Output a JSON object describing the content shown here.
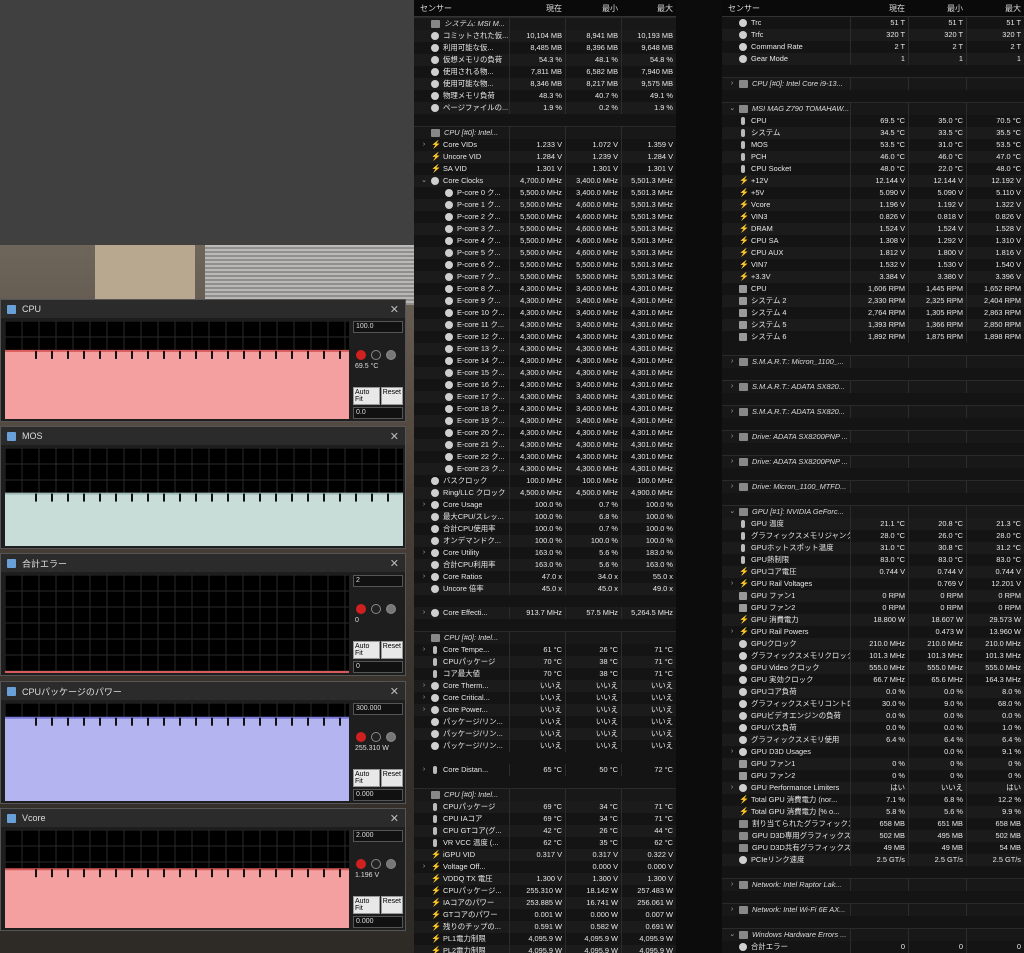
{
  "graphs": [
    {
      "title": "CPU",
      "max": "100.0",
      "current": "69.5 °C",
      "min": "0.0",
      "fill": "#f4a0a0",
      "line": "#d85a5a",
      "level": 0.695,
      "autofit": "Auto Fit",
      "reset": "Reset"
    },
    {
      "title": "MOS",
      "max": "",
      "current": "",
      "min": "",
      "fill": "#c8dcd8",
      "line": "#9fb8b4",
      "level": 0.535,
      "autofit": "",
      "reset": ""
    },
    {
      "title": "合計エラー",
      "max": "2",
      "current": "0",
      "min": "0",
      "fill": "#f4a0a0",
      "line": "#d85a5a",
      "level": 0.0,
      "autofit": "Auto Fit",
      "reset": "Reset"
    },
    {
      "title": "CPUパッケージのパワー",
      "max": "300.000",
      "current": "255.310 W",
      "min": "0.000",
      "fill": "#b4b4f0",
      "line": "#7a7ad8",
      "level": 0.85,
      "autofit": "Auto Fit",
      "reset": "Reset"
    },
    {
      "title": "Vcore",
      "max": "2.000",
      "current": "1.196 V",
      "min": "0.000",
      "fill": "#f4a0a0",
      "line": "#d85a5a",
      "level": 0.6,
      "autofit": "Auto Fit",
      "reset": "Reset"
    }
  ],
  "columns": {
    "sensor": "センサー",
    "current": "現在",
    "min": "最小",
    "max": "最大"
  },
  "left_rows": [
    {
      "t": "g",
      "n": "システム: MSI M..."
    },
    {
      "i": "dot",
      "n": "コミットされた仮...",
      "c": "10,104 MB",
      "mi": "8,941 MB",
      "ma": "10,193 MB"
    },
    {
      "i": "dot",
      "n": "利用可能な仮...",
      "c": "8,485 MB",
      "mi": "8,396 MB",
      "ma": "9,648 MB"
    },
    {
      "i": "dot",
      "n": "仮想メモリの負荷",
      "c": "54.3 %",
      "mi": "48.1 %",
      "ma": "54.8 %"
    },
    {
      "i": "dot",
      "n": "使用される物...",
      "c": "7,811 MB",
      "mi": "6,582 MB",
      "ma": "7,940 MB"
    },
    {
      "i": "dot",
      "n": "使用可能な物...",
      "c": "8,346 MB",
      "mi": "8,217 MB",
      "ma": "9,575 MB"
    },
    {
      "i": "dot",
      "n": "物理メモリ負荷",
      "c": "48.3 %",
      "mi": "40.7 %",
      "ma": "49.1 %"
    },
    {
      "i": "dot",
      "n": "ページファイルの...",
      "c": "1.9 %",
      "mi": "0.2 %",
      "ma": "1.9 %"
    },
    {
      "t": "b"
    },
    {
      "t": "g",
      "n": "CPU [#0]: Intel..."
    },
    {
      "a": ">",
      "i": "bolt",
      "n": "Core VIDs",
      "c": "1.233 V",
      "mi": "1.072 V",
      "ma": "1.359 V"
    },
    {
      "i": "bolt",
      "n": "Uncore VID",
      "c": "1.284 V",
      "mi": "1.239 V",
      "ma": "1.284 V"
    },
    {
      "i": "bolt",
      "n": "SA VID",
      "c": "1.301 V",
      "mi": "1.301 V",
      "ma": "1.301 V"
    },
    {
      "a": "v",
      "i": "dot",
      "n": "Core Clocks",
      "c": "4,700.0 MHz",
      "mi": "3,400.0 MHz",
      "ma": "5,501.3 MHz"
    },
    {
      "s": 1,
      "i": "dot",
      "n": "P-core 0 ク...",
      "c": "5,500.0 MHz",
      "mi": "3,400.0 MHz",
      "ma": "5,501.3 MHz"
    },
    {
      "s": 1,
      "i": "dot",
      "n": "P-core 1 ク...",
      "c": "5,500.0 MHz",
      "mi": "4,600.0 MHz",
      "ma": "5,501.3 MHz"
    },
    {
      "s": 1,
      "i": "dot",
      "n": "P-core 2 ク...",
      "c": "5,500.0 MHz",
      "mi": "4,600.0 MHz",
      "ma": "5,501.3 MHz"
    },
    {
      "s": 1,
      "i": "dot",
      "n": "P-core 3 ク...",
      "c": "5,500.0 MHz",
      "mi": "4,600.0 MHz",
      "ma": "5,501.3 MHz"
    },
    {
      "s": 1,
      "i": "dot",
      "n": "P-core 4 ク...",
      "c": "5,500.0 MHz",
      "mi": "4,600.0 MHz",
      "ma": "5,501.3 MHz"
    },
    {
      "s": 1,
      "i": "dot",
      "n": "P-core 5 ク...",
      "c": "5,500.0 MHz",
      "mi": "4,600.0 MHz",
      "ma": "5,501.3 MHz"
    },
    {
      "s": 1,
      "i": "dot",
      "n": "P-core 6 ク...",
      "c": "5,500.0 MHz",
      "mi": "5,500.0 MHz",
      "ma": "5,501.3 MHz"
    },
    {
      "s": 1,
      "i": "dot",
      "n": "P-core 7 ク...",
      "c": "5,500.0 MHz",
      "mi": "5,500.0 MHz",
      "ma": "5,501.3 MHz"
    },
    {
      "s": 1,
      "i": "dot",
      "n": "E-core 8 ク...",
      "c": "4,300.0 MHz",
      "mi": "3,400.0 MHz",
      "ma": "4,301.0 MHz"
    },
    {
      "s": 1,
      "i": "dot",
      "n": "E-core 9 ク...",
      "c": "4,300.0 MHz",
      "mi": "3,400.0 MHz",
      "ma": "4,301.0 MHz"
    },
    {
      "s": 1,
      "i": "dot",
      "n": "E-core 10 ク...",
      "c": "4,300.0 MHz",
      "mi": "3,400.0 MHz",
      "ma": "4,301.0 MHz"
    },
    {
      "s": 1,
      "i": "dot",
      "n": "E-core 11 ク...",
      "c": "4,300.0 MHz",
      "mi": "3,400.0 MHz",
      "ma": "4,301.0 MHz"
    },
    {
      "s": 1,
      "i": "dot",
      "n": "E-core 12 ク...",
      "c": "4,300.0 MHz",
      "mi": "4,300.0 MHz",
      "ma": "4,301.0 MHz"
    },
    {
      "s": 1,
      "i": "dot",
      "n": "E-core 13 ク...",
      "c": "4,300.0 MHz",
      "mi": "4,300.0 MHz",
      "ma": "4,301.0 MHz"
    },
    {
      "s": 1,
      "i": "dot",
      "n": "E-core 14 ク...",
      "c": "4,300.0 MHz",
      "mi": "4,300.0 MHz",
      "ma": "4,301.0 MHz"
    },
    {
      "s": 1,
      "i": "dot",
      "n": "E-core 15 ク...",
      "c": "4,300.0 MHz",
      "mi": "4,300.0 MHz",
      "ma": "4,301.0 MHz"
    },
    {
      "s": 1,
      "i": "dot",
      "n": "E-core 16 ク...",
      "c": "4,300.0 MHz",
      "mi": "3,400.0 MHz",
      "ma": "4,301.0 MHz"
    },
    {
      "s": 1,
      "i": "dot",
      "n": "E-core 17 ク...",
      "c": "4,300.0 MHz",
      "mi": "3,400.0 MHz",
      "ma": "4,301.0 MHz"
    },
    {
      "s": 1,
      "i": "dot",
      "n": "E-core 18 ク...",
      "c": "4,300.0 MHz",
      "mi": "3,400.0 MHz",
      "ma": "4,301.0 MHz"
    },
    {
      "s": 1,
      "i": "dot",
      "n": "E-core 19 ク...",
      "c": "4,300.0 MHz",
      "mi": "3,400.0 MHz",
      "ma": "4,301.0 MHz"
    },
    {
      "s": 1,
      "i": "dot",
      "n": "E-core 20 ク...",
      "c": "4,300.0 MHz",
      "mi": "4,300.0 MHz",
      "ma": "4,301.0 MHz"
    },
    {
      "s": 1,
      "i": "dot",
      "n": "E-core 21 ク...",
      "c": "4,300.0 MHz",
      "mi": "4,300.0 MHz",
      "ma": "4,301.0 MHz"
    },
    {
      "s": 1,
      "i": "dot",
      "n": "E-core 22 ク...",
      "c": "4,300.0 MHz",
      "mi": "4,300.0 MHz",
      "ma": "4,301.0 MHz"
    },
    {
      "s": 1,
      "i": "dot",
      "n": "E-core 23 ク...",
      "c": "4,300.0 MHz",
      "mi": "4,300.0 MHz",
      "ma": "4,301.0 MHz"
    },
    {
      "i": "dot",
      "n": "バスクロック",
      "c": "100.0 MHz",
      "mi": "100.0 MHz",
      "ma": "100.0 MHz"
    },
    {
      "i": "dot",
      "n": "Ring/LLC クロック",
      "c": "4,500.0 MHz",
      "mi": "4,500.0 MHz",
      "ma": "4,900.0 MHz"
    },
    {
      "a": ">",
      "i": "dot",
      "n": "Core Usage",
      "c": "100.0 %",
      "mi": "0.7 %",
      "ma": "100.0 %"
    },
    {
      "i": "dot",
      "n": "最大CPU/スレッ...",
      "c": "100.0 %",
      "mi": "6.8 %",
      "ma": "100.0 %"
    },
    {
      "i": "dot",
      "n": "合計CPU使用率",
      "c": "100.0 %",
      "mi": "0.7 %",
      "ma": "100.0 %"
    },
    {
      "i": "dot",
      "n": "オンデマンドク...",
      "c": "100.0 %",
      "mi": "100.0 %",
      "ma": "100.0 %"
    },
    {
      "a": ">",
      "i": "dot",
      "n": "Core Utility",
      "c": "163.0 %",
      "mi": "5.6 %",
      "ma": "183.0 %"
    },
    {
      "i": "dot",
      "n": "合計CPU利用率",
      "c": "163.0 %",
      "mi": "5.6 %",
      "ma": "163.0 %"
    },
    {
      "a": ">",
      "i": "dot",
      "n": "Core Ratios",
      "c": "47.0 x",
      "mi": "34.0 x",
      "ma": "55.0 x"
    },
    {
      "i": "dot",
      "n": "Uncore 倍率",
      "c": "45.0 x",
      "mi": "45.0 x",
      "ma": "49.0 x"
    },
    {
      "t": "b"
    },
    {
      "a": ">",
      "i": "dot",
      "n": "Core Effecti...",
      "c": "913.7 MHz",
      "mi": "57.5 MHz",
      "ma": "5,264.5 MHz"
    },
    {
      "t": "b"
    },
    {
      "t": "g",
      "n": "CPU [#0]: Intel..."
    },
    {
      "a": ">",
      "i": "therm",
      "n": "Core Tempe...",
      "c": "61 °C",
      "mi": "26 °C",
      "ma": "71 °C"
    },
    {
      "i": "therm",
      "n": "CPUパッケージ",
      "c": "70 °C",
      "mi": "38 °C",
      "ma": "71 °C"
    },
    {
      "i": "therm",
      "n": "コア最大値",
      "c": "70 °C",
      "mi": "38 °C",
      "ma": "71 °C"
    },
    {
      "a": ">",
      "i": "dot",
      "n": "Core Therm...",
      "c": "いいえ",
      "mi": "いいえ",
      "ma": "いいえ"
    },
    {
      "a": ">",
      "i": "dot",
      "n": "Core Critical...",
      "c": "いいえ",
      "mi": "いいえ",
      "ma": "いいえ"
    },
    {
      "a": ">",
      "i": "dot",
      "n": "Core Power...",
      "c": "いいえ",
      "mi": "いいえ",
      "ma": "いいえ"
    },
    {
      "i": "dot",
      "n": "パッケージ/リン...",
      "c": "いいえ",
      "mi": "いいえ",
      "ma": "いいえ"
    },
    {
      "i": "dot",
      "n": "パッケージ/リン...",
      "c": "いいえ",
      "mi": "いいえ",
      "ma": "いいえ"
    },
    {
      "i": "dot",
      "n": "パッケージ/リン...",
      "c": "いいえ",
      "mi": "いいえ",
      "ma": "いいえ"
    },
    {
      "t": "b"
    },
    {
      "a": ">",
      "i": "therm",
      "n": "Core Distan...",
      "c": "65 °C",
      "mi": "50 °C",
      "ma": "72 °C"
    },
    {
      "t": "b"
    },
    {
      "t": "g",
      "n": "CPU [#0]: Intel..."
    },
    {
      "i": "therm",
      "n": "CPUパッケージ",
      "c": "69 °C",
      "mi": "34 °C",
      "ma": "71 °C"
    },
    {
      "i": "therm",
      "n": "CPU IAコア",
      "c": "69 °C",
      "mi": "34 °C",
      "ma": "71 °C"
    },
    {
      "i": "therm",
      "n": "CPU GTコア(グ...",
      "c": "42 °C",
      "mi": "26 °C",
      "ma": "44 °C"
    },
    {
      "i": "therm",
      "n": "VR VCC 温度 (...",
      "c": "62 °C",
      "mi": "35 °C",
      "ma": "62 °C"
    },
    {
      "i": "bolt",
      "n": "iGPU VID",
      "c": "0.317 V",
      "mi": "0.317 V",
      "ma": "0.322 V"
    },
    {
      "a": ">",
      "i": "bolt",
      "n": "Voltage Off...",
      "c": "",
      "mi": "0.000 V",
      "ma": "0.000 V"
    },
    {
      "i": "bolt",
      "n": "VDDQ TX 電圧",
      "c": "1.300 V",
      "mi": "1.300 V",
      "ma": "1.300 V"
    },
    {
      "i": "bolt",
      "n": "CPUパッケージ...",
      "c": "255.310 W",
      "mi": "18.142 W",
      "ma": "257.483 W"
    },
    {
      "i": "bolt",
      "n": "IAコアのパワー",
      "c": "253.885 W",
      "mi": "16.741 W",
      "ma": "256.061 W"
    },
    {
      "i": "bolt",
      "n": "GTコアのパワー",
      "c": "0.001 W",
      "mi": "0.000 W",
      "ma": "0.007 W"
    },
    {
      "i": "bolt",
      "n": "残りのチップの...",
      "c": "0.591 W",
      "mi": "0.582 W",
      "ma": "0.691 W"
    },
    {
      "i": "bolt",
      "n": "PL1電力制限",
      "c": "4,095.9 W",
      "mi": "4,095.9 W",
      "ma": "4,095.9 W"
    },
    {
      "i": "bolt",
      "n": "PL2電力制限",
      "c": "4,095.9 W",
      "mi": "4,095.9 W",
      "ma": "4,095.9 W"
    }
  ],
  "right_rows": [
    {
      "i": "dot",
      "n": "Trc",
      "c": "51 T",
      "mi": "51 T",
      "ma": "51 T"
    },
    {
      "i": "dot",
      "n": "Trfc",
      "c": "320 T",
      "mi": "320 T",
      "ma": "320 T"
    },
    {
      "i": "dot",
      "n": "Command Rate",
      "c": "2 T",
      "mi": "2 T",
      "ma": "2 T"
    },
    {
      "i": "dot",
      "n": "Gear Mode",
      "c": "1",
      "mi": "1",
      "ma": "1"
    },
    {
      "t": "b"
    },
    {
      "t": "g",
      "a": ">",
      "n": "CPU [#0]: Intel Core i9-13..."
    },
    {
      "t": "b"
    },
    {
      "t": "g",
      "a": "v",
      "n": "MSI MAG Z790 TOMAHAW..."
    },
    {
      "i": "therm",
      "n": "CPU",
      "c": "69.5 °C",
      "mi": "35.0 °C",
      "ma": "70.5 °C"
    },
    {
      "i": "therm",
      "n": "システム",
      "c": "34.5 °C",
      "mi": "33.5 °C",
      "ma": "35.5 °C"
    },
    {
      "i": "therm",
      "n": "MOS",
      "c": "53.5 °C",
      "mi": "31.0 °C",
      "ma": "53.5 °C"
    },
    {
      "i": "therm",
      "n": "PCH",
      "c": "46.0 °C",
      "mi": "46.0 °C",
      "ma": "47.0 °C"
    },
    {
      "i": "therm",
      "n": "CPU Socket",
      "c": "48.0 °C",
      "mi": "22.0 °C",
      "ma": "48.0 °C"
    },
    {
      "i": "bolt",
      "n": "+12V",
      "c": "12.144 V",
      "mi": "12.144 V",
      "ma": "12.192 V"
    },
    {
      "i": "bolt",
      "n": "+5V",
      "c": "5.090 V",
      "mi": "5.090 V",
      "ma": "5.110 V"
    },
    {
      "i": "bolt",
      "n": "Vcore",
      "c": "1.196 V",
      "mi": "1.192 V",
      "ma": "1.322 V"
    },
    {
      "i": "bolt",
      "n": "VIN3",
      "c": "0.826 V",
      "mi": "0.818 V",
      "ma": "0.826 V"
    },
    {
      "i": "bolt",
      "n": "DRAM",
      "c": "1.524 V",
      "mi": "1.524 V",
      "ma": "1.528 V"
    },
    {
      "i": "bolt",
      "n": "CPU SA",
      "c": "1.308 V",
      "mi": "1.292 V",
      "ma": "1.310 V"
    },
    {
      "i": "bolt",
      "n": "CPU AUX",
      "c": "1.812 V",
      "mi": "1.800 V",
      "ma": "1.816 V"
    },
    {
      "i": "bolt",
      "n": "VIN7",
      "c": "1.532 V",
      "mi": "1.530 V",
      "ma": "1.540 V"
    },
    {
      "i": "bolt",
      "n": "+3.3V",
      "c": "3.384 V",
      "mi": "3.380 V",
      "ma": "3.396 V"
    },
    {
      "i": "fan",
      "n": "CPU",
      "c": "1,606 RPM",
      "mi": "1,445 RPM",
      "ma": "1,652 RPM"
    },
    {
      "i": "fan",
      "n": "システム 2",
      "c": "2,330 RPM",
      "mi": "2,325 RPM",
      "ma": "2,404 RPM"
    },
    {
      "i": "fan",
      "n": "システム 4",
      "c": "2,764 RPM",
      "mi": "1,305 RPM",
      "ma": "2,863 RPM"
    },
    {
      "i": "fan",
      "n": "システム 5",
      "c": "1,393 RPM",
      "mi": "1,366 RPM",
      "ma": "2,850 RPM"
    },
    {
      "i": "fan",
      "n": "システム 6",
      "c": "1,892 RPM",
      "mi": "1,875 RPM",
      "ma": "1,898 RPM"
    },
    {
      "t": "b"
    },
    {
      "t": "g",
      "a": ">",
      "n": "S.M.A.R.T.: Micron_1100_..."
    },
    {
      "t": "b"
    },
    {
      "t": "g",
      "a": ">",
      "n": "S.M.A.R.T.: ADATA SX820..."
    },
    {
      "t": "b"
    },
    {
      "t": "g",
      "a": ">",
      "n": "S.M.A.R.T.: ADATA SX820..."
    },
    {
      "t": "b"
    },
    {
      "t": "g",
      "a": ">",
      "n": "Drive: ADATA SX8200PNP ..."
    },
    {
      "t": "b"
    },
    {
      "t": "g",
      "a": ">",
      "n": "Drive: ADATA SX8200PNP ..."
    },
    {
      "t": "b"
    },
    {
      "t": "g",
      "a": ">",
      "n": "Drive: Micron_1100_MTFD..."
    },
    {
      "t": "b"
    },
    {
      "t": "g",
      "a": "v",
      "n": "GPU [#1]: NVIDIA GeForc..."
    },
    {
      "i": "therm",
      "n": "GPU 温度",
      "c": "21.1 °C",
      "mi": "20.8 °C",
      "ma": "21.3 °C"
    },
    {
      "i": "therm",
      "n": "グラフィックスメモリジャンクシ...",
      "c": "28.0 °C",
      "mi": "26.0 °C",
      "ma": "28.0 °C"
    },
    {
      "i": "therm",
      "n": "GPUホットスポット温度",
      "c": "31.0 °C",
      "mi": "30.8 °C",
      "ma": "31.2 °C"
    },
    {
      "i": "therm",
      "n": "GPU熱制限",
      "c": "83.0 °C",
      "mi": "83.0 °C",
      "ma": "83.0 °C"
    },
    {
      "i": "bolt",
      "n": "GPUコア電圧",
      "c": "0.744 V",
      "mi": "0.744 V",
      "ma": "0.744 V"
    },
    {
      "a": ">",
      "i": "bolt",
      "n": "GPU Rail Voltages",
      "c": "",
      "mi": "0.769 V",
      "ma": "12.201 V"
    },
    {
      "i": "fan",
      "n": "GPU ファン1",
      "c": "0 RPM",
      "mi": "0 RPM",
      "ma": "0 RPM"
    },
    {
      "i": "fan",
      "n": "GPU ファン2",
      "c": "0 RPM",
      "mi": "0 RPM",
      "ma": "0 RPM"
    },
    {
      "i": "bolt",
      "n": "GPU 消費電力",
      "c": "18.800 W",
      "mi": "18.607 W",
      "ma": "29.573 W"
    },
    {
      "a": ">",
      "i": "bolt",
      "n": "GPU Rail Powers",
      "c": "",
      "mi": "0.473 W",
      "ma": "13.960 W"
    },
    {
      "i": "dot",
      "n": "GPUクロック",
      "c": "210.0 MHz",
      "mi": "210.0 MHz",
      "ma": "210.0 MHz"
    },
    {
      "i": "dot",
      "n": "グラフィックスメモリクロック",
      "c": "101.3 MHz",
      "mi": "101.3 MHz",
      "ma": "101.3 MHz"
    },
    {
      "i": "dot",
      "n": "GPU Video クロック",
      "c": "555.0 MHz",
      "mi": "555.0 MHz",
      "ma": "555.0 MHz"
    },
    {
      "i": "dot",
      "n": "GPU 実効クロック",
      "c": "66.7 MHz",
      "mi": "65.6 MHz",
      "ma": "164.3 MHz"
    },
    {
      "i": "dot",
      "n": "GPUコア負荷",
      "c": "0.0 %",
      "mi": "0.0 %",
      "ma": "8.0 %"
    },
    {
      "i": "dot",
      "n": "グラフィックスメモリコントロー...",
      "c": "30.0 %",
      "mi": "9.0 %",
      "ma": "68.0 %"
    },
    {
      "i": "dot",
      "n": "GPUビデオエンジンの負荷",
      "c": "0.0 %",
      "mi": "0.0 %",
      "ma": "0.0 %"
    },
    {
      "i": "dot",
      "n": "GPUバス負荷",
      "c": "0.0 %",
      "mi": "0.0 %",
      "ma": "1.0 %"
    },
    {
      "i": "dot",
      "n": "グラフィックスメモリ使用",
      "c": "6.4 %",
      "mi": "6.4 %",
      "ma": "6.4 %"
    },
    {
      "a": ">",
      "i": "dot",
      "n": "GPU D3D Usages",
      "c": "",
      "mi": "0.0 %",
      "ma": "9.1 %"
    },
    {
      "i": "fan",
      "n": "GPU ファン1",
      "c": "0 %",
      "mi": "0 %",
      "ma": "0 %"
    },
    {
      "i": "fan",
      "n": "GPU ファン2",
      "c": "0 %",
      "mi": "0 %",
      "ma": "0 %"
    },
    {
      "a": ">",
      "i": "dot",
      "n": "GPU Performance Limiters",
      "c": "はい",
      "mi": "いいえ",
      "ma": "はい"
    },
    {
      "i": "bolt",
      "n": "Total GPU 消費電力 (nor...",
      "c": "7.1 %",
      "mi": "6.8 %",
      "ma": "12.2 %"
    },
    {
      "i": "bolt",
      "n": "Total GPU 消費電力 [% o...",
      "c": "5.8 %",
      "mi": "5.6 %",
      "ma": "9.9 %"
    },
    {
      "i": "chip",
      "n": "割り当てられたグラフィックス...",
      "c": "658 MB",
      "mi": "651 MB",
      "ma": "658 MB"
    },
    {
      "i": "chip",
      "n": "GPU D3D専用グラフィックス...",
      "c": "502 MB",
      "mi": "495 MB",
      "ma": "502 MB"
    },
    {
      "i": "chip",
      "n": "GPU D3D共有グラフィックス...",
      "c": "49 MB",
      "mi": "49 MB",
      "ma": "54 MB"
    },
    {
      "i": "dot",
      "n": "PCIeリンク速度",
      "c": "2.5 GT/s",
      "mi": "2.5 GT/s",
      "ma": "2.5 GT/s"
    },
    {
      "t": "b"
    },
    {
      "t": "g",
      "a": ">",
      "n": "Network: Intel Raptor Lak..."
    },
    {
      "t": "b"
    },
    {
      "t": "g",
      "a": ">",
      "n": "Network: Intel Wi-Fi 6E AX..."
    },
    {
      "t": "b"
    },
    {
      "t": "g",
      "a": "v",
      "n": "Windows Hardware Errors ..."
    },
    {
      "i": "dot",
      "n": "合計エラー",
      "c": "0",
      "mi": "0",
      "ma": "0"
    }
  ]
}
